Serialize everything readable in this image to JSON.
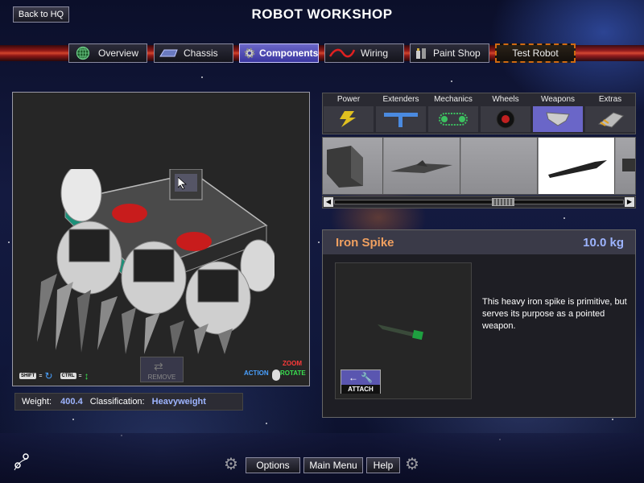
{
  "header": {
    "back_label": "Back to HQ",
    "title": "ROBOT WORKSHOP"
  },
  "tabs": [
    {
      "label": "Overview",
      "icon": "globe-icon"
    },
    {
      "label": "Chassis",
      "icon": "chassis-icon"
    },
    {
      "label": "Components",
      "icon": "gear-icon",
      "active": true
    },
    {
      "label": "Wiring",
      "icon": "wire-icon"
    },
    {
      "label": "Paint Shop",
      "icon": "paint-icon"
    },
    {
      "label": "Test Robot",
      "icon": ""
    }
  ],
  "viewport": {
    "shift_key": "SHIFT",
    "ctrl_key": "CTRL",
    "remove_label": "REMOVE",
    "zoom_label": "ZOOM",
    "action_label": "ACTION",
    "rotate_label": "ROTATE"
  },
  "stats": {
    "weight_label": "Weight:",
    "weight_value": "400.4",
    "class_label": "Classification:",
    "class_value": "Heavyweight"
  },
  "categories": [
    {
      "label": "Power",
      "icon": "lightning-icon"
    },
    {
      "label": "Extenders",
      "icon": "extender-icon"
    },
    {
      "label": "Mechanics",
      "icon": "chain-icon"
    },
    {
      "label": "Wheels",
      "icon": "wheel-icon"
    },
    {
      "label": "Weapons",
      "icon": "blade-icon",
      "active": true
    },
    {
      "label": "Extras",
      "icon": "extras-icon"
    }
  ],
  "parts_strip": {
    "selected_index": 3,
    "scroll_prev": "◀",
    "scroll_next": "▶"
  },
  "detail": {
    "name": "Iron Spike",
    "weight": "10.0 kg",
    "description": "This heavy iron spike is primitive, but serves its purpose as a pointed weapon.",
    "attach_label": "ATTACH"
  },
  "footer": {
    "options_label": "Options",
    "main_menu_label": "Main Menu",
    "help_label": "Help"
  },
  "colors": {
    "accent": "#6a66c8",
    "part_name": "#f0a060",
    "value_blue": "#9db4ff",
    "test_border": "#d06a10"
  }
}
